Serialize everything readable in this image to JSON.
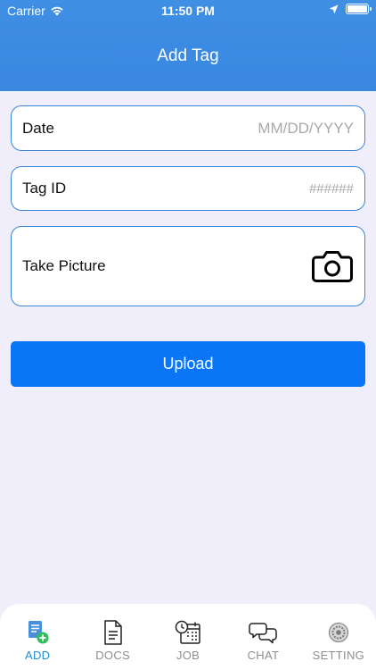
{
  "status_bar": {
    "carrier": "Carrier",
    "time": "11:50 PM"
  },
  "header": {
    "title": "Add Tag"
  },
  "form": {
    "date": {
      "label": "Date",
      "placeholder": "MM/DD/YYYY"
    },
    "tag_id": {
      "label": "Tag ID",
      "placeholder": "######"
    },
    "picture": {
      "label": "Take Picture",
      "icon": "camera-icon"
    }
  },
  "upload_label": "Upload",
  "tabs": [
    {
      "label": "ADD",
      "icon": "add-document-icon",
      "active": true
    },
    {
      "label": "DOCS",
      "icon": "document-icon",
      "active": false
    },
    {
      "label": "JOB",
      "icon": "calendar-clock-icon",
      "active": false
    },
    {
      "label": "CHAT",
      "icon": "chat-bubbles-icon",
      "active": false
    },
    {
      "label": "SETTING",
      "icon": "gear-icon",
      "active": false
    }
  ],
  "colors": {
    "header": "#3f8fe4",
    "accent": "#0a76f7",
    "active_tab": "#1f8fd4",
    "border": "#3a86d8"
  }
}
